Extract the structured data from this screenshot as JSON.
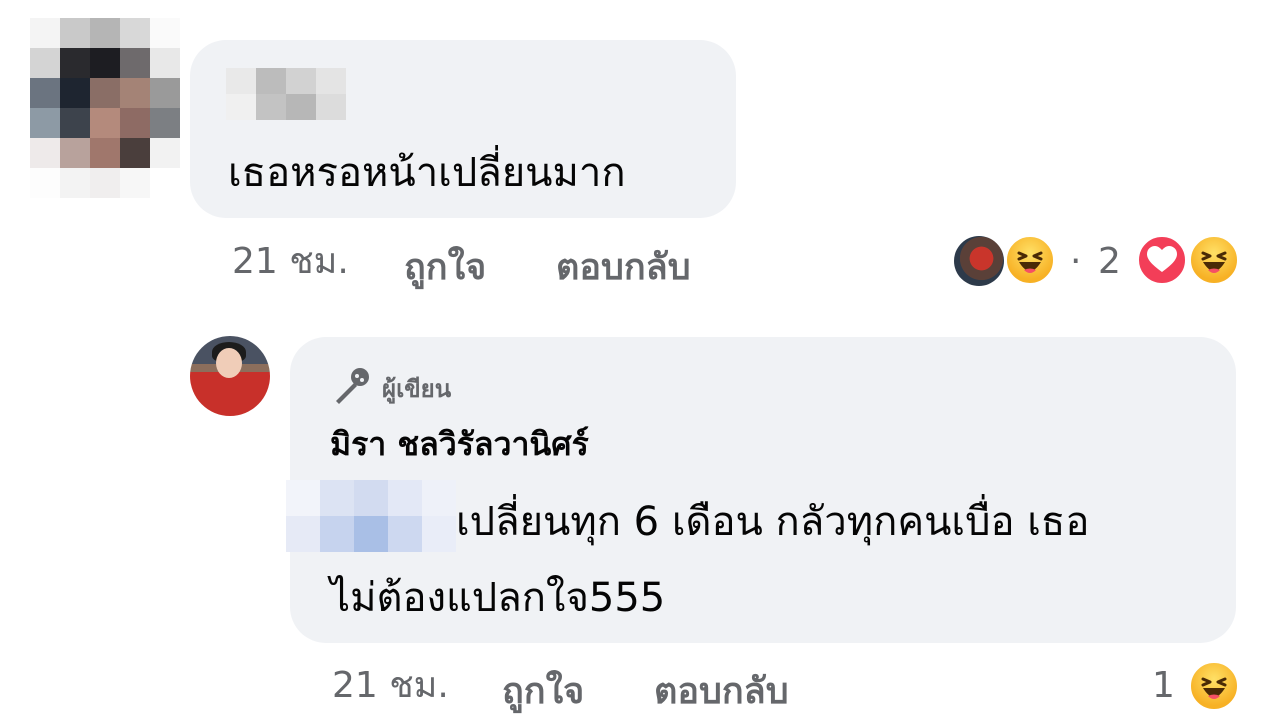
{
  "comment": {
    "text": "เธอหรอหน้าเปลี่ยนมาก",
    "time": "21 ชม.",
    "like_label": "ถูกใจ",
    "reply_label": "ตอบกลับ",
    "reaction_separator": "·",
    "reaction_count": "2"
  },
  "reply": {
    "author_badge_label": "ผู้เขียน",
    "author_name": "มิรา ชลวิรัลวานิศร์",
    "text_line1": "เปลี่ยนทุก 6 เดือน กลัวทุกคนเบื่อ เธอ",
    "text_line2": "ไม่ต้องแปลกใจ555",
    "time": "21 ชม.",
    "like_label": "ถูกใจ",
    "reply_label": "ตอบกลับ",
    "reaction_count": "1"
  },
  "icons": {
    "author_badge": "microphone-icon",
    "haha": "haha-reaction-icon",
    "love": "love-reaction-icon"
  },
  "colors": {
    "bubble": "#f0f2f5",
    "meta_text": "#65676b",
    "love": "#f33e58",
    "haha": "#f7b125"
  }
}
